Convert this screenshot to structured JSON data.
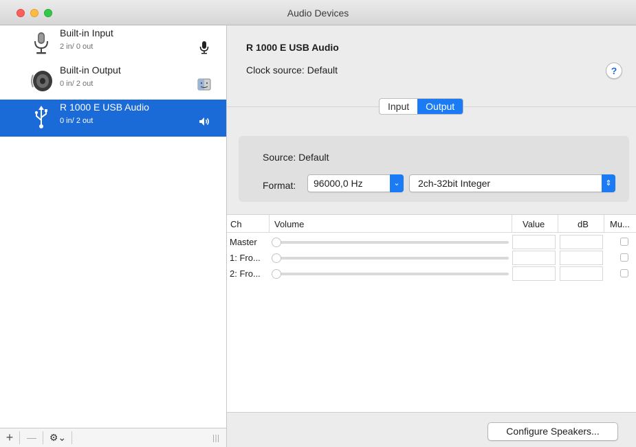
{
  "window": {
    "title": "Audio Devices"
  },
  "sidebar": {
    "devices": [
      {
        "name": "Built-in Input",
        "io": "2 in/ 0 out",
        "icon": "microphone-icon",
        "badge": "microphone-icon"
      },
      {
        "name": "Built-in Output",
        "io": "0 in/ 2 out",
        "icon": "speaker-icon",
        "badge": "finder-icon"
      },
      {
        "name": "R 1000 E  USB Audio",
        "io": "0 in/ 2 out",
        "icon": "usb-icon",
        "badge": "speaker-volume-icon",
        "selected": true
      }
    ],
    "bottom": {
      "add": "+",
      "remove": "—",
      "gear": "⚙︎⌄"
    }
  },
  "detail": {
    "device_title": "R 1000 E  USB Audio",
    "clock_label": "Clock source:",
    "clock_value": "Default",
    "help": "?",
    "tabs": [
      {
        "label": "Input"
      },
      {
        "label": "Output",
        "active": true
      }
    ],
    "source_label": "Source:",
    "source_value": "Default",
    "format_label": "Format:",
    "format_rate": "96000,0 Hz",
    "format_type": "2ch-32bit Integer",
    "table": {
      "headers": {
        "ch": "Ch",
        "volume": "Volume",
        "value": "Value",
        "db": "dB",
        "mute": "Mu..."
      },
      "rows": [
        {
          "ch": "Master"
        },
        {
          "ch": "1: Fro..."
        },
        {
          "ch": "2: Fro..."
        }
      ]
    },
    "configure_button": "Configure Speakers..."
  },
  "colors": {
    "accent": "#1a7bf5",
    "selection": "#1a6ad7"
  }
}
